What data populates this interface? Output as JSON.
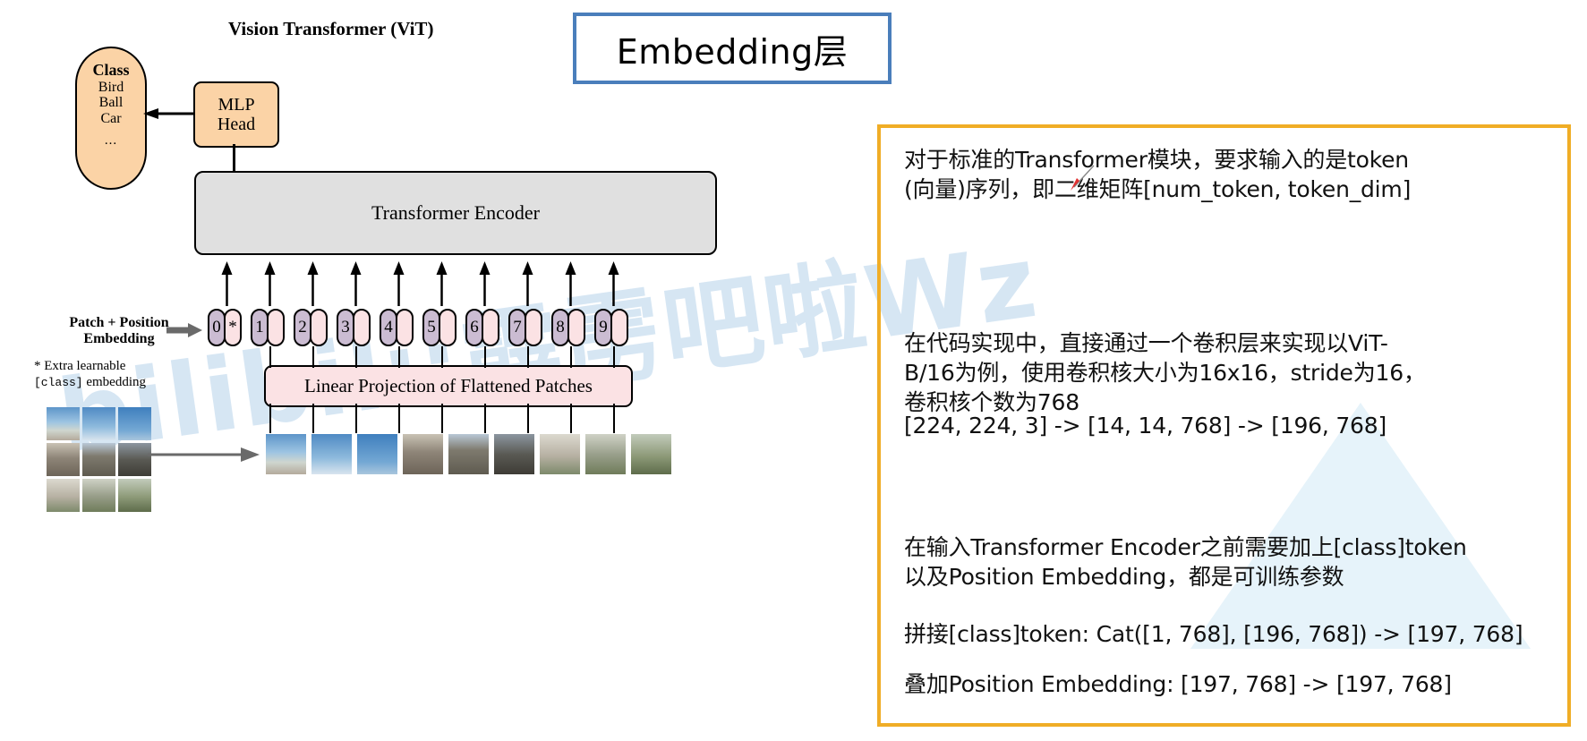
{
  "diagram": {
    "title": "Vision Transformer (ViT)",
    "banner_text": "Embedding层",
    "class_pill": {
      "head": "Class",
      "items": [
        "Bird",
        "Ball",
        "Car"
      ],
      "ellipsis": "..."
    },
    "mlp_head": {
      "line1": "MLP",
      "line2": "Head"
    },
    "encoder_label": "Transformer Encoder",
    "patch_position_label_line1": "Patch + Position",
    "patch_position_label_line2": "Embedding",
    "extra_note_line1": "* Extra learnable",
    "extra_note_mono": "[class]",
    "extra_note_line2_tail": " embedding",
    "linear_projection_label": "Linear Projection of Flattened Patches",
    "class_token_marker": "*",
    "tokens": [
      "0",
      "1",
      "2",
      "3",
      "4",
      "5",
      "6",
      "7",
      "8",
      "9"
    ],
    "token_count": 10
  },
  "watermark": {
    "text": "bilibili:霹雳吧啦Wz"
  },
  "info_panel": {
    "border_color": "#f0ad26",
    "paragraphs": [
      "对于标准的Transformer模块，要求输入的是token\n(向量)序列，即二维矩阵[num_token, token_dim]",
      "在代码实现中，直接通过一个卷积层来实现以ViT-\nB/16为例，使用卷积核大小为16x16，stride为16，\n卷积核个数为768",
      "[224, 224, 3] -> [14, 14, 768] -> [196, 768]",
      "在输入Transformer Encoder之前需要加上[class]token\n以及Position Embedding，都是可训练参数",
      "拼接[class]token:  Cat([1, 768], [196, 768]) -> [197, 768]",
      "叠加Position Embedding:  [197, 768] -> [197, 768]"
    ]
  },
  "colors": {
    "banner_border": "#4a7ebb",
    "panel_border": "#f0ad26",
    "class_pill_fill": "#fbd3a6",
    "encoder_fill": "#e0e0e0",
    "token_num_fill": "#cbbcd2",
    "token_blank_fill": "#fbe2e4",
    "linear_projection_fill": "#fbe2e4",
    "watermark": "#cfe2f2",
    "annotation_red": "#e03030"
  }
}
